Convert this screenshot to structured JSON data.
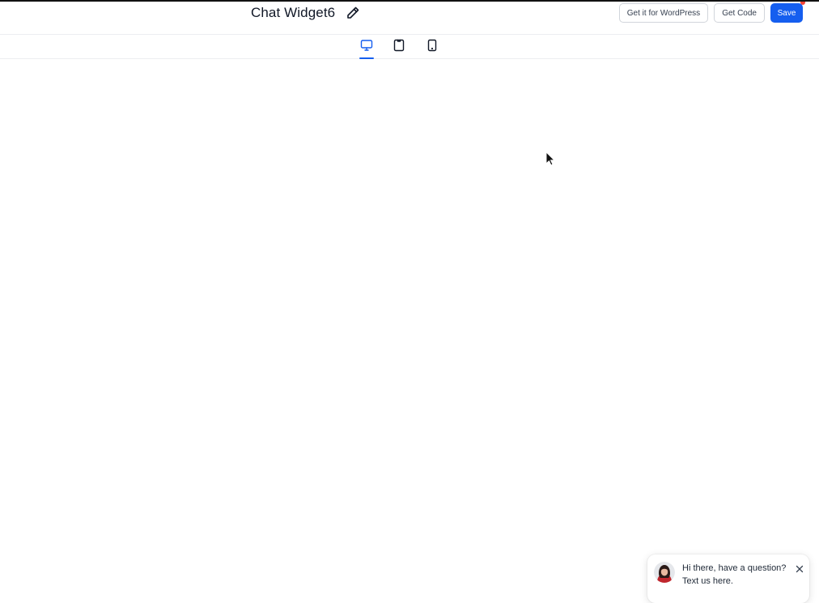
{
  "header": {
    "title": "Chat Widget6",
    "wordpress_label": "Get it for WordPress",
    "get_code_label": "Get Code",
    "save_label": "Save"
  },
  "device_tabs": [
    {
      "name": "desktop",
      "icon": "monitor-icon",
      "active": true
    },
    {
      "name": "tablet",
      "icon": "tablet-icon",
      "active": false
    },
    {
      "name": "mobile",
      "icon": "phone-icon",
      "active": false
    }
  ],
  "chat_widget": {
    "line1": "Hi there, have a question?",
    "line2": "Text us here."
  },
  "colors": {
    "primary": "#155eef",
    "notification": "#f04438",
    "text": "#111827"
  }
}
